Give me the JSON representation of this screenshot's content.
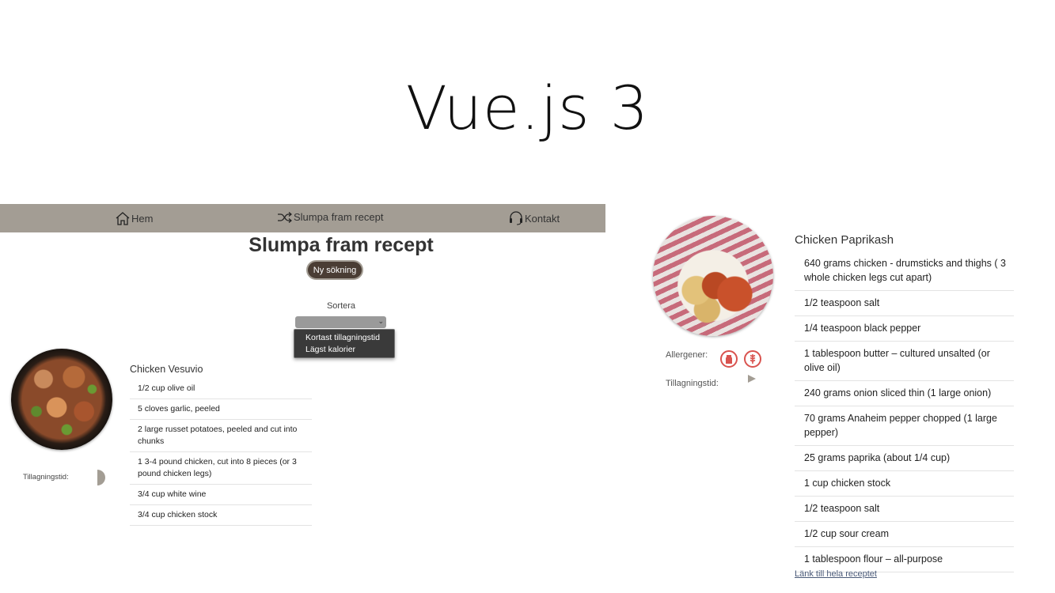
{
  "slide": {
    "title": "Vue.js 3"
  },
  "left": {
    "nav": {
      "home": "Hem",
      "random": "Slumpa fram recept",
      "contact": "Kontakt"
    },
    "heading": "Slumpa fram recept",
    "new_search": "Ny sökning",
    "sort": {
      "label": "Sortera",
      "options": [
        "Kortast tillagningstid",
        "Lägst kalorier"
      ]
    },
    "cook_time_label": "Tillagningstid:",
    "recipe": {
      "title": "Chicken Vesuvio",
      "ingredients": [
        "1/2 cup olive oil",
        "5 cloves garlic, peeled",
        "2 large russet potatoes, peeled and cut into chunks",
        "1 3-4 pound chicken, cut into 8 pieces (or 3 pound chicken legs)",
        "3/4 cup white wine",
        "3/4 cup chicken stock"
      ]
    }
  },
  "right": {
    "allergens_label": "Allergener:",
    "cook_time_label": "Tillagningstid:",
    "recipe": {
      "title": "Chicken Paprikash",
      "ingredients": [
        "640 grams chicken - drumsticks and thighs ( 3 whole chicken legs cut apart)",
        "1/2 teaspoon salt",
        "1/4 teaspoon black pepper",
        "1 tablespoon butter – cultured unsalted (or olive oil)",
        "240 grams onion sliced thin (1 large onion)",
        "70 grams Anaheim pepper chopped (1 large pepper)",
        "25 grams paprika (about 1/4 cup)",
        "1 cup chicken stock",
        "1/2 teaspoon salt",
        "1/2 cup sour cream",
        "1 tablespoon flour – all-purpose"
      ]
    },
    "link": "Länk till hela receptet"
  },
  "colors": {
    "navbar": "#a39d94",
    "button": "#4a3d34",
    "allergen": "#d9534f"
  }
}
